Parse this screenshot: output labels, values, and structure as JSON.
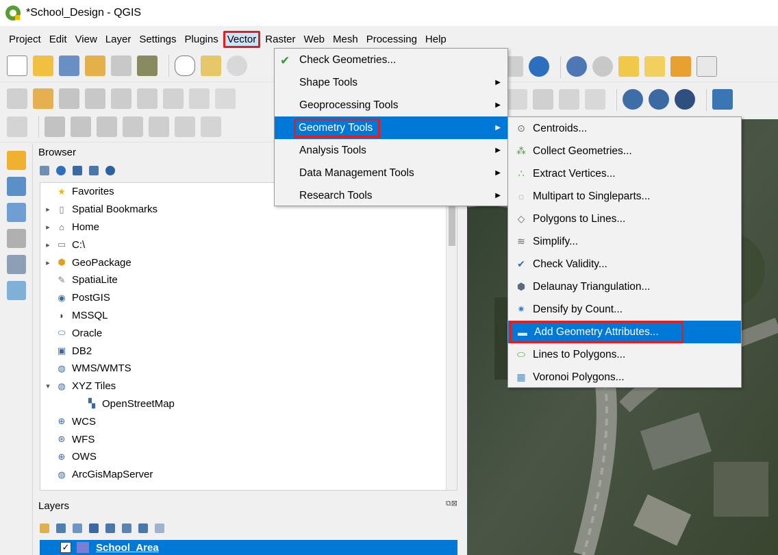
{
  "window": {
    "title": "*School_Design - QGIS"
  },
  "menubar": {
    "items": [
      "Project",
      "Edit",
      "View",
      "Layer",
      "Settings",
      "Plugins",
      "Vector",
      "Raster",
      "Web",
      "Mesh",
      "Processing",
      "Help"
    ],
    "active": "Vector"
  },
  "vector_menu": {
    "items": [
      {
        "label": "Check Geometries...",
        "has_submenu": false
      },
      {
        "label": "Shape Tools",
        "has_submenu": true
      },
      {
        "label": "Geoprocessing Tools",
        "has_submenu": true
      },
      {
        "label": "Geometry Tools",
        "has_submenu": true,
        "highlighted": true
      },
      {
        "label": "Analysis Tools",
        "has_submenu": true
      },
      {
        "label": "Data Management Tools",
        "has_submenu": true
      },
      {
        "label": "Research Tools",
        "has_submenu": true
      }
    ]
  },
  "geometry_submenu": {
    "items": [
      {
        "label": "Centroids...",
        "icon": "centroids-icon"
      },
      {
        "label": "Collect Geometries...",
        "icon": "collect-icon"
      },
      {
        "label": "Extract Vertices...",
        "icon": "vertices-icon"
      },
      {
        "label": "Multipart to Singleparts...",
        "icon": "multipart-icon"
      },
      {
        "label": "Polygons to Lines...",
        "icon": "polygon-lines-icon"
      },
      {
        "label": "Simplify...",
        "icon": "simplify-icon"
      },
      {
        "label": "Check Validity...",
        "icon": "check-validity-icon"
      },
      {
        "label": "Delaunay Triangulation...",
        "icon": "delaunay-icon"
      },
      {
        "label": "Densify by Count...",
        "icon": "densify-icon"
      },
      {
        "label": "Add Geometry Attributes...",
        "icon": "ruler-icon",
        "highlighted": true
      },
      {
        "label": "Lines to Polygons...",
        "icon": "lines-polygon-icon"
      },
      {
        "label": "Voronoi Polygons...",
        "icon": "voronoi-icon"
      }
    ]
  },
  "browser": {
    "title": "Browser",
    "items": [
      {
        "label": "Favorites",
        "expand": "",
        "icon": "star-icon",
        "indent": 0
      },
      {
        "label": "Spatial Bookmarks",
        "expand": "▸",
        "icon": "bookmark-icon",
        "indent": 0
      },
      {
        "label": "Home",
        "expand": "▸",
        "icon": "home-icon",
        "indent": 0
      },
      {
        "label": "C:\\",
        "expand": "▸",
        "icon": "folder-icon",
        "indent": 0
      },
      {
        "label": "GeoPackage",
        "expand": "▸",
        "icon": "geopackage-icon",
        "indent": 0
      },
      {
        "label": "SpatiaLite",
        "expand": "",
        "icon": "feather-icon",
        "indent": 0
      },
      {
        "label": "PostGIS",
        "expand": "",
        "icon": "elephant-icon",
        "indent": 0
      },
      {
        "label": "MSSQL",
        "expand": "",
        "icon": "mssql-icon",
        "indent": 0
      },
      {
        "label": "Oracle",
        "expand": "",
        "icon": "oracle-icon",
        "indent": 0
      },
      {
        "label": "DB2",
        "expand": "",
        "icon": "db2-icon",
        "indent": 0
      },
      {
        "label": "WMS/WMTS",
        "expand": "",
        "icon": "globe-icon",
        "indent": 0
      },
      {
        "label": "XYZ Tiles",
        "expand": "▾",
        "icon": "globe-icon",
        "indent": 0
      },
      {
        "label": "OpenStreetMap",
        "expand": "",
        "icon": "tiles-icon",
        "indent": 1
      },
      {
        "label": "WCS",
        "expand": "",
        "icon": "wcs-icon",
        "indent": 0
      },
      {
        "label": "WFS",
        "expand": "",
        "icon": "wfs-icon",
        "indent": 0
      },
      {
        "label": "OWS",
        "expand": "",
        "icon": "ows-icon",
        "indent": 0
      },
      {
        "label": "ArcGisMapServer",
        "expand": "",
        "icon": "globe-icon",
        "indent": 0
      }
    ]
  },
  "layers": {
    "title": "Layers",
    "items": [
      {
        "label": "School_Area",
        "checked": true,
        "color": "#7b7fd4"
      }
    ]
  },
  "colors": {
    "highlight": "#0078d7",
    "annotation": "#e02020"
  }
}
